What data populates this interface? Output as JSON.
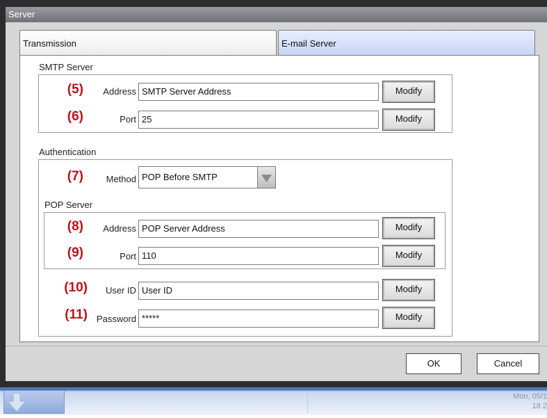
{
  "window": {
    "title": "Server"
  },
  "tabs": [
    {
      "label": "Transmission",
      "selected": false
    },
    {
      "label": "E-mail Server",
      "selected": true
    }
  ],
  "smtp": {
    "group_label": "SMTP Server",
    "address": {
      "num": "(5)",
      "label": "Address",
      "value": "SMTP Server Address",
      "button": "Modify"
    },
    "port": {
      "num": "(6)",
      "label": "Port",
      "value": "25",
      "button": "Modify"
    }
  },
  "auth": {
    "group_label": "Authentication",
    "method": {
      "num": "(7)",
      "label": "Method",
      "value": "POP Before SMTP"
    },
    "pop": {
      "group_label": "POP Server",
      "address": {
        "num": "(8)",
        "label": "Address",
        "value": "POP Server Address",
        "button": "Modify"
      },
      "port": {
        "num": "(9)",
        "label": "Port",
        "value": "110",
        "button": "Modify"
      }
    },
    "userid": {
      "num": "(10)",
      "label": "User ID",
      "value": "User ID",
      "button": "Modify"
    },
    "password": {
      "num": "(11)",
      "label": "Password",
      "value": "*****",
      "button": "Modify"
    }
  },
  "footer": {
    "ok": "OK",
    "cancel": "Cancel"
  },
  "taskbar": {
    "date_line1": "Mon, 05/1",
    "date_line2": "18 2"
  },
  "colors": {
    "annotation": "#c0101a",
    "taskbar_blue": "#3a66b4"
  }
}
